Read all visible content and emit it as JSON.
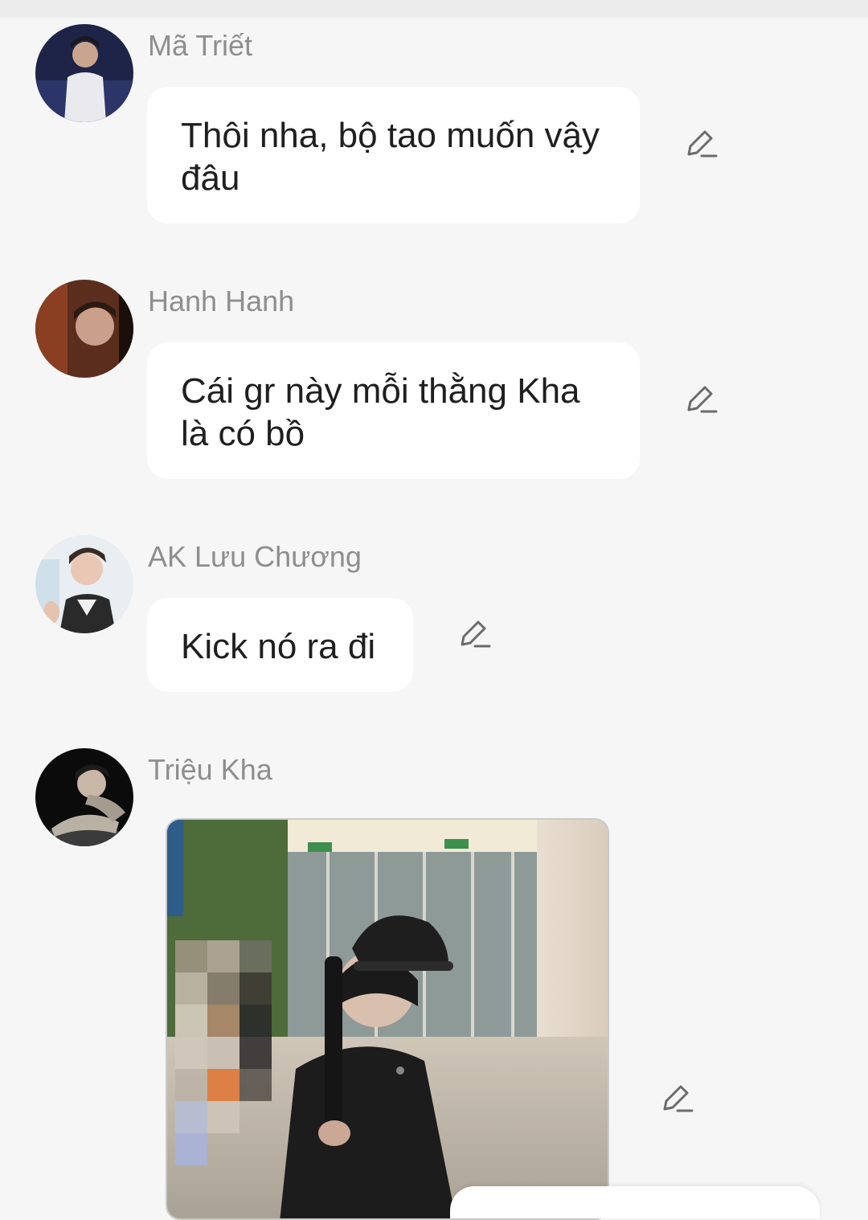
{
  "messages": [
    {
      "sender": "Mã Triết",
      "text_lines": [
        "Thôi nha, bộ tao muốn vậy",
        "đâu"
      ],
      "icon": "edit-icon"
    },
    {
      "sender": "Hanh Hanh",
      "text_lines": [
        "Cái gr này mỗi thằng Kha",
        "là có bồ"
      ],
      "icon": "edit-icon"
    },
    {
      "sender": "AK Lưu Chương",
      "text_lines": [
        "Kick nó ra đi"
      ],
      "icon": "edit-icon"
    },
    {
      "sender": "Triệu Kha",
      "attachment": "photo",
      "icon": "edit-icon"
    }
  ],
  "colors": {
    "background": "#f6f6f6",
    "bubble": "#ffffff",
    "sender_name": "#8e8e8e",
    "message_text": "#1f1f1f"
  }
}
